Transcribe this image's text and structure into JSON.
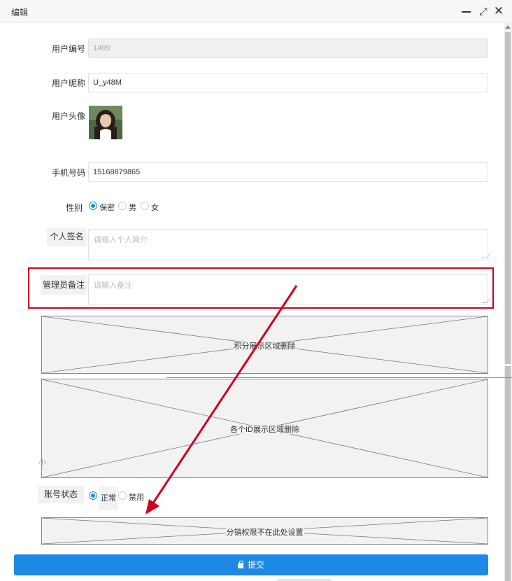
{
  "window": {
    "title": "编辑",
    "minimize_icon": "minimize-icon",
    "maximize_icon": "maximize-icon",
    "close_icon": "close-icon",
    "maximize_glyph": "⤢",
    "close_glyph": "✕"
  },
  "form": {
    "user_id": {
      "label": "用户编号",
      "value": "1499",
      "disabled": true
    },
    "nickname": {
      "label": "用户昵称",
      "value": "U_y48M"
    },
    "avatar": {
      "label": "用户头像"
    },
    "phone": {
      "label": "手机号码",
      "value": "15168879865"
    },
    "gender": {
      "label": "性别",
      "options": [
        "保密",
        "男",
        "女"
      ],
      "selected": "保密"
    },
    "signature": {
      "label": "个人签名",
      "placeholder": "请输入个人简介"
    },
    "admin_note": {
      "label": "管理员备注",
      "placeholder": "请输入备注"
    },
    "points_area": {
      "text": "积分展示区域删除"
    },
    "ids_area": {
      "text": "各个ID展示区域删除"
    },
    "account_status": {
      "label": "账号状态",
      "options": [
        "正常",
        "禁用"
      ],
      "selected": "正常"
    },
    "distribution_area": {
      "text": "分销权限不在此处设置"
    },
    "left_stub": "小",
    "submit": {
      "label": "提交",
      "icon": "lock-icon"
    }
  },
  "colors": {
    "accent": "#1e88e5",
    "annotation_red": "#d0021b",
    "annotation_orange": "#d97b4a"
  }
}
